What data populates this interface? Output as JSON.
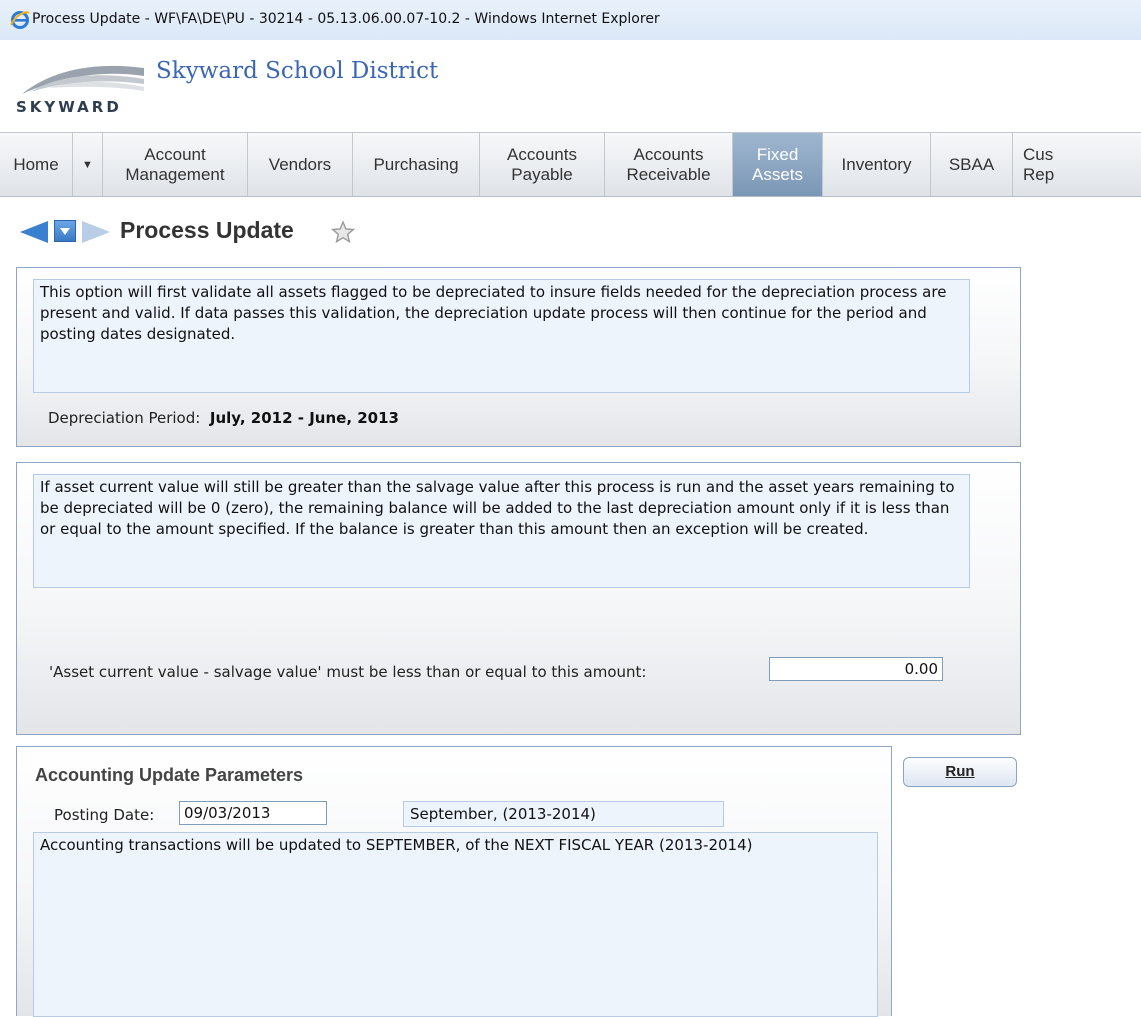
{
  "window": {
    "title": "Process Update - WF\\FA\\DE\\PU - 30214 - 05.13.06.00.07-10.2 - Windows Internet Explorer"
  },
  "header": {
    "logo_text": "SKYWARD",
    "district_name": "Skyward School District"
  },
  "nav": {
    "items": [
      {
        "label": "Home"
      },
      {
        "label": "Account Management"
      },
      {
        "label": "Vendors"
      },
      {
        "label": "Purchasing"
      },
      {
        "label": "Accounts Payable"
      },
      {
        "label": "Accounts Receivable"
      },
      {
        "label": "Fixed Assets",
        "active": true
      },
      {
        "label": "Inventory"
      },
      {
        "label": "SBAA"
      },
      {
        "label": "Cus Rep"
      }
    ],
    "active_color": "#8aa5c3"
  },
  "page": {
    "title": "Process Update"
  },
  "panel1": {
    "info": "This option will first validate all assets flagged to be depreciated to insure fields needed for the depreciation process are present and valid.  If data passes this validation, the depreciation update process will then continue for the period and posting dates designated.",
    "period_label": "Depreciation Period:",
    "period_value": "July, 2012 - June, 2013"
  },
  "panel2": {
    "info": "If asset current value will still be greater than the salvage value after this process is run and the asset years remaining to be depreciated will be 0 (zero), the remaining balance will be added to the last depreciation amount only if it is less than or equal to the amount specified.  If the balance is greater than this amount then an exception will be created.",
    "amount_label": "'Asset current value - salvage value' must be less than or equal to this amount:",
    "amount_value": "0.00"
  },
  "panel3": {
    "title": "Accounting Update Parameters",
    "posting_date_label": "Posting Date:",
    "posting_date_value": "09/03/2013",
    "period_display": "September, (2013-2014)",
    "info": "Accounting transactions will be updated to SEPTEMBER, of the NEXT FISCAL YEAR (2013-2014)"
  },
  "actions": {
    "run_label": "Run"
  }
}
